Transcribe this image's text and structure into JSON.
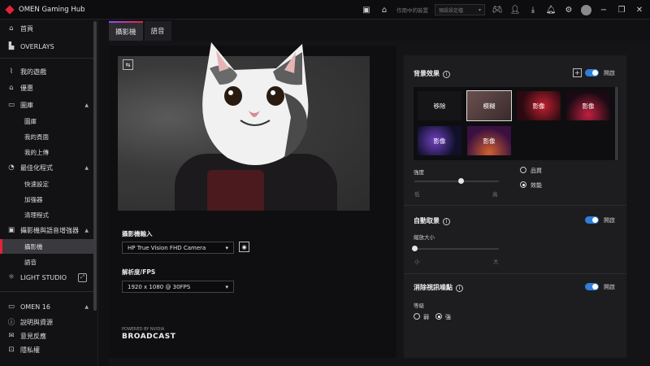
{
  "app": {
    "title": "OMEN Gaming Hub",
    "brand_color": "#e2233a",
    "accent_color": "#2f7ed8"
  },
  "titlebar": {
    "active_label": "作用中的裝置",
    "profile_placeholder": "預設設定檔"
  },
  "sidebar": {
    "items": [
      {
        "label": "首頁",
        "icon": "home-icon"
      },
      {
        "label": "OVERLAYS",
        "icon": "overlays-icon"
      },
      {
        "label": "我的遊戲",
        "icon": "chart-icon"
      },
      {
        "label": "優惠",
        "icon": "tag-icon"
      },
      {
        "label": "圖庫",
        "icon": "gallery-icon"
      },
      {
        "label": "圖庫"
      },
      {
        "label": "我的頁面"
      },
      {
        "label": "我的上傳"
      },
      {
        "label": "最佳化程式",
        "icon": "optimizer-icon"
      },
      {
        "label": "快速設定"
      },
      {
        "label": "加強器"
      },
      {
        "label": "清理程式"
      },
      {
        "label": "攝影機與語音增強器",
        "icon": "camera-icon"
      },
      {
        "label": "攝影機"
      },
      {
        "label": "語音"
      },
      {
        "label": "LIGHT STUDIO",
        "icon": "lightbulb-icon"
      },
      {
        "label": "OMEN 16",
        "icon": "laptop-icon"
      },
      {
        "label": "說明與資源",
        "icon": "help-icon"
      },
      {
        "label": "意見反應",
        "icon": "feedback-icon"
      },
      {
        "label": "隱私權",
        "icon": "lock-icon"
      }
    ]
  },
  "tabs": [
    {
      "label": "攝影機"
    },
    {
      "label": "語音"
    }
  ],
  "camera": {
    "input_label": "攝影機輸入",
    "input_value": "HP True Vision FHD Camera",
    "resolution_label": "解析度/FPS",
    "resolution_value": "1920 x 1080 @ 30FPS",
    "nvidia_small": "POWERED BY NVIDIA",
    "nvidia_big": "BROADCAST"
  },
  "background": {
    "title": "背景效果",
    "toggle_label": "開啟",
    "effects": [
      {
        "label": "移除"
      },
      {
        "label": "模糊"
      },
      {
        "label": "影像"
      },
      {
        "label": "影像"
      },
      {
        "label": "影像"
      },
      {
        "label": "影像"
      }
    ],
    "strength_label": "強度",
    "low": "低",
    "high": "高",
    "strength_value": 0.55,
    "quality_label": "品質",
    "performance_label": "效能"
  },
  "autoframe": {
    "title": "自動取景",
    "toggle_label": "開啟",
    "zoom_label": "縮放大小",
    "small": "小",
    "large": "大",
    "zoom_value": 0.0
  },
  "noise": {
    "title": "消除視訊噪點",
    "toggle_label": "開啟",
    "level_label": "等級",
    "weak": "弱",
    "strong": "強"
  }
}
